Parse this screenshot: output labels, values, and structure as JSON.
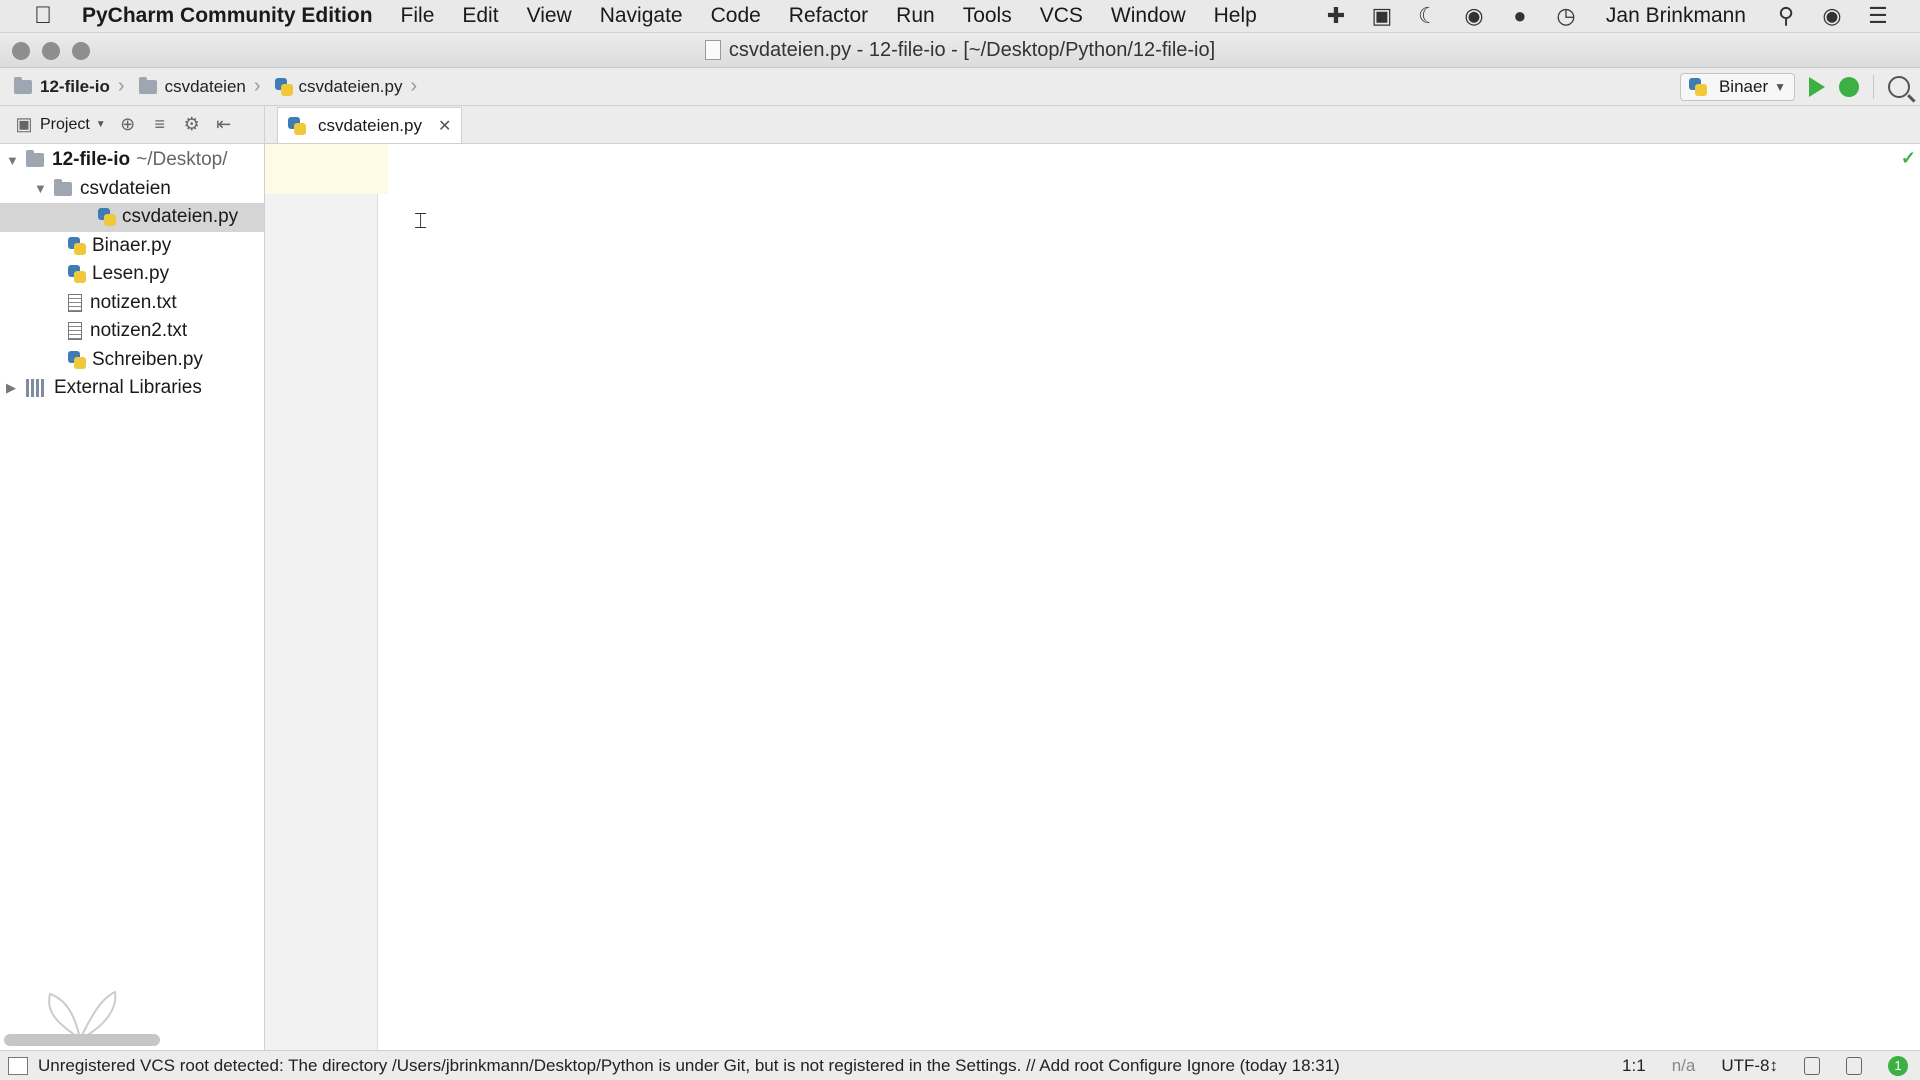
{
  "menubar": {
    "app_name": "PyCharm Community Edition",
    "items": [
      "File",
      "Edit",
      "View",
      "Navigate",
      "Code",
      "Refactor",
      "Run",
      "Tools",
      "VCS",
      "Window",
      "Help"
    ],
    "user": "Jan Brinkmann",
    "system_icons": [
      "plugin-icon",
      "media-icon",
      "moon-icon",
      "camera-icon",
      "chat-icon",
      "history-icon"
    ]
  },
  "window": {
    "title": "csvdateien.py - 12-file-io - [~/Desktop/Python/12-file-io]"
  },
  "breadcrumb": {
    "items": [
      "12-file-io",
      "csvdateien",
      "csvdateien.py"
    ]
  },
  "run_config": {
    "selected": "Binaer"
  },
  "project_panel": {
    "label": "Project",
    "tree": {
      "root_name": "12-file-io",
      "root_path": "~/Desktop/",
      "folder": "csvdateien",
      "selected_file": "csvdateien.py",
      "files": [
        "Binaer.py",
        "Lesen.py",
        "notizen.txt",
        "notizen2.txt",
        "Schreiben.py"
      ],
      "libraries": "External Libraries"
    }
  },
  "editor": {
    "tabs": [
      {
        "label": "csvdateien.py"
      }
    ]
  },
  "statusbar": {
    "message": "Unregistered VCS root detected: The directory /Users/jbrinkmann/Desktop/Python is under Git, but is not registered in the Settings. // Add root  Configure  Ignore (today 18:31)",
    "position": "1:1",
    "na": "n/a",
    "encoding": "UTF-8↕",
    "notifications": "1"
  }
}
